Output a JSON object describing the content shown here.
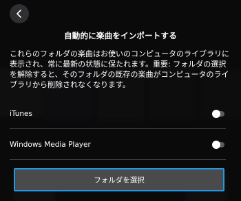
{
  "header": {
    "back_icon": "chevron-left-icon"
  },
  "dialog": {
    "title": "自動的に楽曲をインポートする",
    "description": "これらのフォルダの楽曲はお使いのコンピュータのライブラリに表示され、常に最新の状態に保たれます。重要: フォルダの選択を解除すると、そのフォルダの既存の楽曲がコンピュータのライブラリから削除されなくなります。",
    "options": [
      {
        "label": "iTunes",
        "enabled": false
      },
      {
        "label": "Windows Media Player",
        "enabled": false
      }
    ],
    "select_button_label": "フォルダを選択"
  },
  "colors": {
    "accent": "#1f9be6",
    "background": "#0d0d0e",
    "button": "#4a4a4c"
  }
}
